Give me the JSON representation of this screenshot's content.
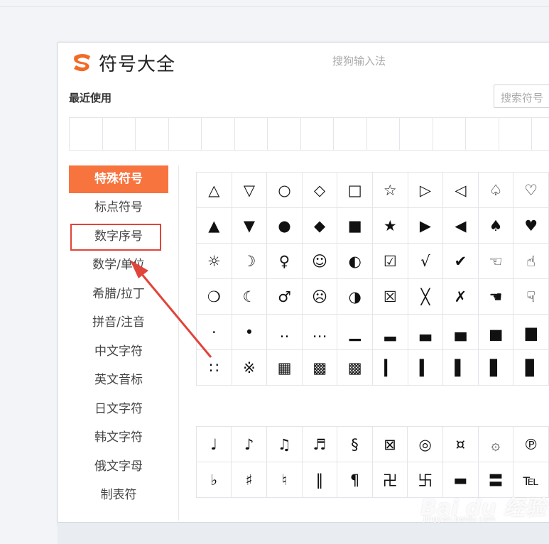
{
  "header": {
    "title": "符号大全",
    "brand": "搜狗输入法",
    "search_placeholder": "搜索符号",
    "logo_color": "#f26b26"
  },
  "recent": {
    "label": "最近使用",
    "slots": 14
  },
  "sidebar": {
    "active_color": "#f8743f",
    "items": [
      {
        "label": "特殊符号",
        "active": true
      },
      {
        "label": "标点符号"
      },
      {
        "label": "数字序号",
        "highlighted": true
      },
      {
        "label": "数学/单位"
      },
      {
        "label": "希腊/拉丁"
      },
      {
        "label": "拼音/注音"
      },
      {
        "label": "中文字符"
      },
      {
        "label": "英文音标"
      },
      {
        "label": "日文字符"
      },
      {
        "label": "韩文字符"
      },
      {
        "label": "俄文字母"
      },
      {
        "label": "制表符"
      }
    ]
  },
  "grid1": [
    [
      "△",
      "▽",
      "○",
      "◇",
      "□",
      "☆",
      "▷",
      "◁",
      "♤",
      "♡"
    ],
    [
      "▲",
      "▼",
      "●",
      "◆",
      "■",
      "★",
      "▶",
      "◀",
      "♠",
      "♥"
    ],
    [
      "☼",
      "☽",
      "♀",
      "☺",
      "◐",
      "☑",
      "√",
      "✔",
      "☜",
      "☝"
    ],
    [
      "❍",
      "☾",
      "♂",
      "☹",
      "◑",
      "☒",
      "╳",
      "✗",
      "☚",
      "☟"
    ],
    [
      "·",
      "•",
      "‥",
      "…",
      "▁",
      "▂",
      "▃",
      "▄",
      "▅",
      "▆"
    ],
    [
      "∷",
      "※",
      "▦",
      "▩",
      "▩",
      "▎",
      "▍",
      "▌",
      "▋",
      "▊"
    ]
  ],
  "grid2": [
    [
      "♩",
      "♪",
      "♫",
      "♬",
      "§",
      "⊠",
      "◎",
      "¤",
      "۞",
      "℗"
    ],
    [
      "♭",
      "♯",
      "♮",
      "‖",
      "¶",
      "卍",
      "卐",
      "▬",
      "〓",
      "℡"
    ]
  ],
  "watermark": {
    "text": "Bai du 经验",
    "sub": "jingyan.baidu.com"
  },
  "annotation": {
    "color": "#e1443a"
  }
}
